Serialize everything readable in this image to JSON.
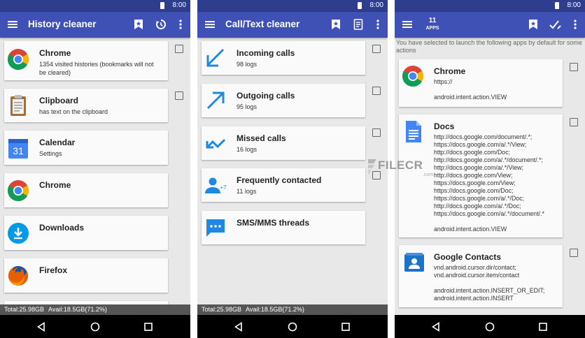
{
  "status": {
    "time": "8:00"
  },
  "screens": [
    {
      "title": "History cleaner",
      "items": [
        {
          "name": "Chrome",
          "sub": "1354 visited histories (bookmarks will not be cleared)",
          "icon": "chrome-icon"
        },
        {
          "name": "Clipboard",
          "sub": "has text on the clipboard",
          "icon": "clipboard-icon"
        },
        {
          "name": "Calendar",
          "sub": "Settings",
          "icon": "calendar-icon",
          "icon_text": "31"
        },
        {
          "name": "Chrome",
          "sub": "",
          "icon": "chrome-icon"
        },
        {
          "name": "Downloads",
          "sub": "",
          "icon": "downloads-icon"
        },
        {
          "name": "Firefox",
          "sub": "",
          "icon": "firefox-icon"
        }
      ]
    },
    {
      "title": "Call/Text cleaner",
      "items": [
        {
          "name": "Incoming calls",
          "sub": "98 logs",
          "icon": "incoming-call-arrow-icon"
        },
        {
          "name": "Outgoing calls",
          "sub": "95 logs",
          "icon": "outgoing-call-arrow-icon"
        },
        {
          "name": "Missed calls",
          "sub": "16 logs",
          "icon": "missed-call-arrow-icon"
        },
        {
          "name": "Frequently contacted",
          "sub": "11 logs",
          "icon": "contact-person-icon",
          "icon_text": "+7"
        },
        {
          "name": "SMS/MMS threads",
          "sub": "",
          "icon": "sms-bubble-icon"
        }
      ]
    },
    {
      "apps_count": "11",
      "apps_label": "APPS",
      "notice": "You have selected to launch the following apps by default for some actions",
      "items": [
        {
          "name": "Chrome",
          "body": "https://\n\nandroid.intent.action.VIEW",
          "icon": "chrome-icon"
        },
        {
          "name": "Docs",
          "body": "http://docs.google.com/document/.*; https://docs.google.com/a/.*/View; http://docs.google.com/Doc; http://docs.google.com/a/.*/document/.*; http://docs.google.com/a/.*/View; http://docs.google.com/View; https://docs.google.com/View; https://docs.google.com/Doc; https://docs.google.com/a/.*/Doc; http://docs.google.com/a/.*/Doc; https://docs.google.com/a/.*/document/.*\n\nandroid.intent.action.VIEW",
          "icon": "docs-icon"
        },
        {
          "name": "Google Contacts",
          "body": "vnd.android.cursor.dir/contact; vnd.android.cursor.item/contact\n\nandroid.intent.action.INSERT_OR_EDIT; android.intent.action.INSERT",
          "icon": "contacts-icon"
        }
      ]
    }
  ],
  "footer": {
    "total": "Total:25.98GB",
    "avail": "Avail:18.5GB(71.2%)"
  },
  "watermark": {
    "text": "FILECR",
    "sub": ".com"
  },
  "colors": {
    "appbar": "#3f51b5",
    "statusbar": "#2f3d8f",
    "background": "#e8e8e8"
  }
}
